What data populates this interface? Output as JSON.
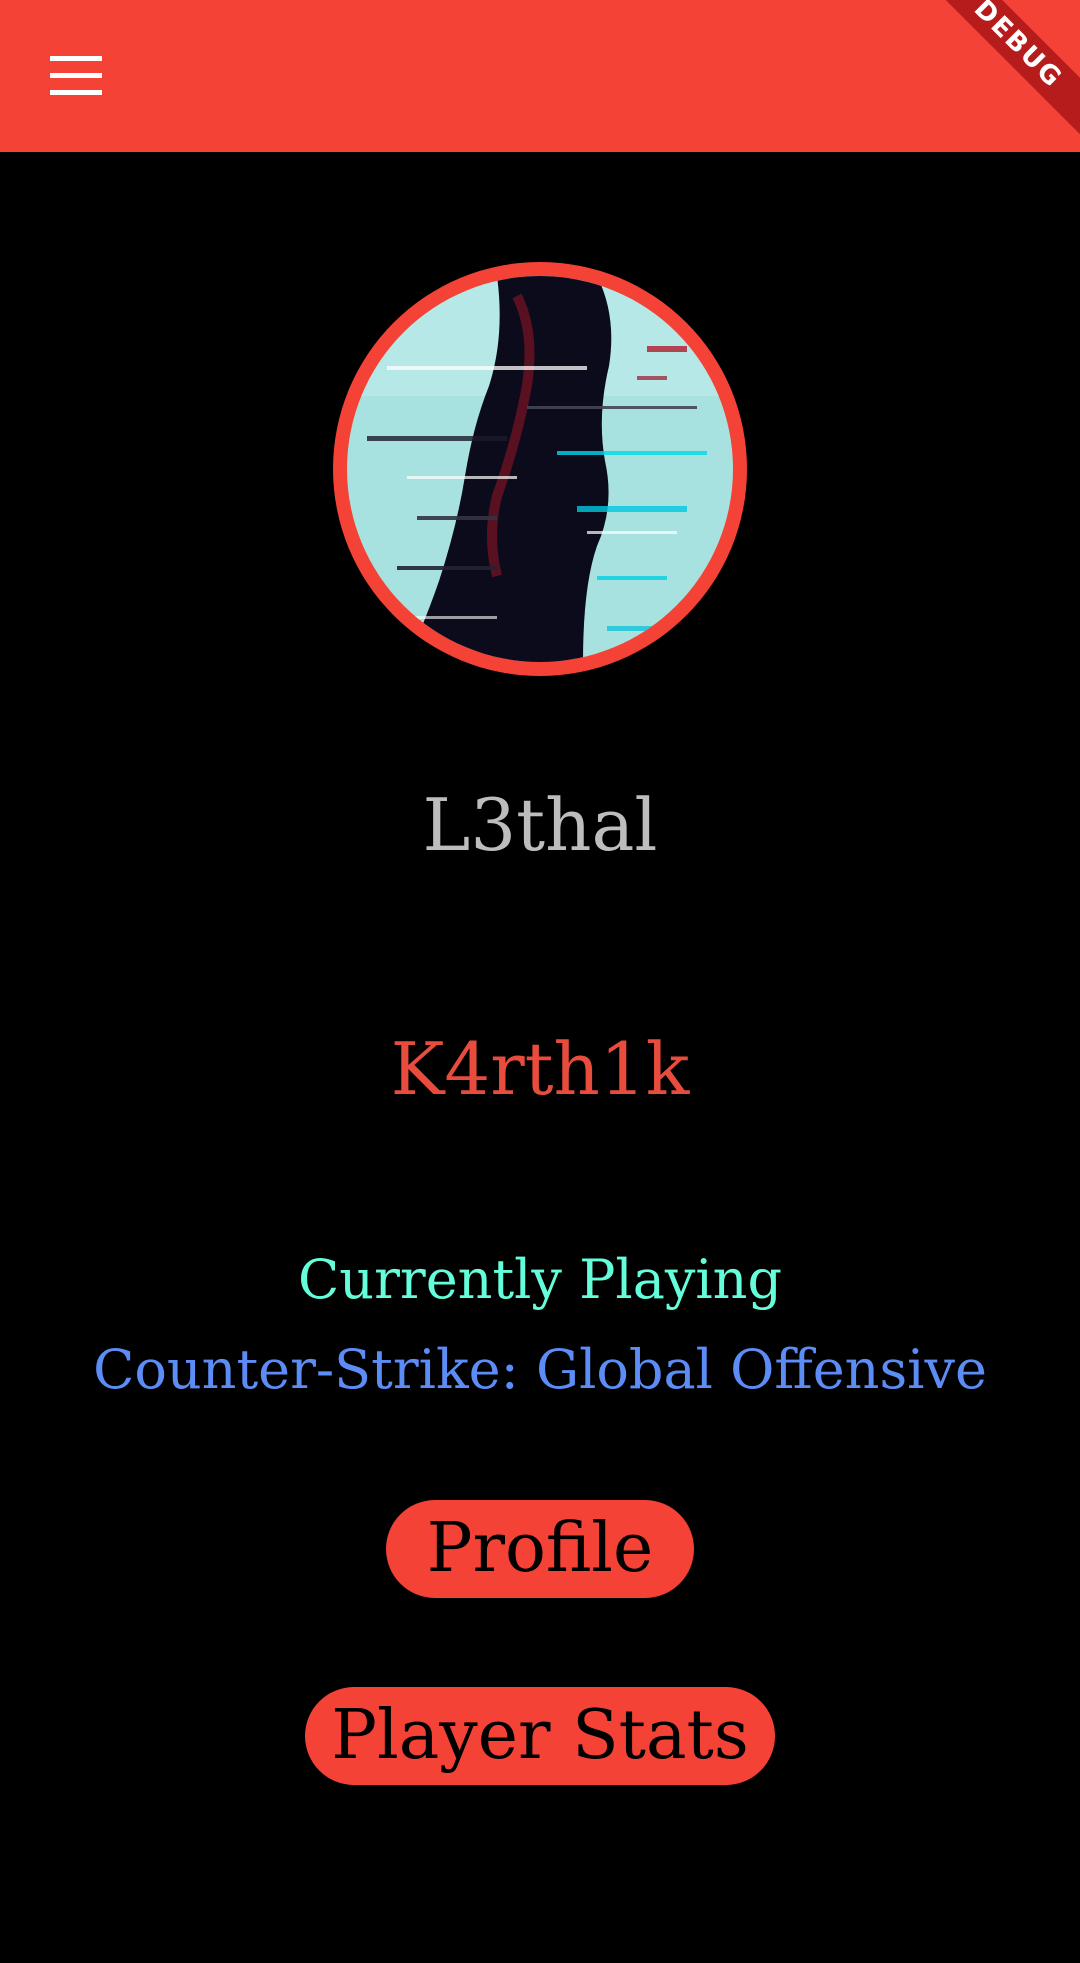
{
  "app_bar": {
    "color": "#f44336",
    "menu_icon": "hamburger-menu-icon",
    "debug_banner": "DEBUG"
  },
  "profile": {
    "avatar_icon": "glitch-silhouette-avatar",
    "avatar_ring_color": "#f44336",
    "handle": "L3thal",
    "username": "K4rth1k",
    "currently_playing_label": "Currently Playing",
    "game_title": "Counter-Strike: Global Offensive"
  },
  "actions": {
    "profile_label": "Profile",
    "player_stats_label": "Player Stats"
  },
  "colors": {
    "background": "#000000",
    "accent": "#f44336",
    "handle": "#bdbdbd",
    "username": "#e74c3c",
    "playing_label": "#64ffda",
    "game_title": "#5c8df6"
  }
}
